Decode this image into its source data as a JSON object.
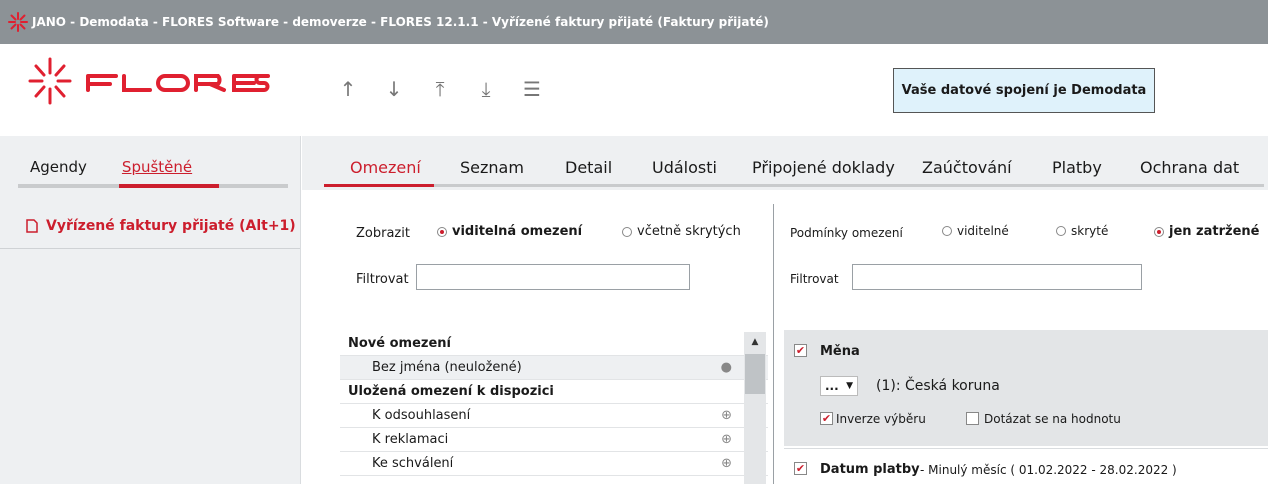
{
  "window": {
    "title": "JANO - Demodata - FLORES Software - demoverze - FLORES 12.1.1 - Vyřízené faktury přijaté  (Faktury přijaté)"
  },
  "header": {
    "logo_text": "FLORES",
    "nav_icons": [
      "arrow-up-icon",
      "arrow-down-icon",
      "arrow-to-top-icon",
      "arrow-to-bottom-icon",
      "menu-icon"
    ],
    "connection_text": "Vaše datové spojení je Demodata"
  },
  "sidebar": {
    "tabs": [
      {
        "label": "Agendy"
      },
      {
        "label": "Spuštěné"
      }
    ],
    "active_tab": "Spuštěné",
    "items": [
      {
        "label": "Vyřízené faktury přijaté (Alt+1)"
      }
    ]
  },
  "tabs": [
    {
      "label": "Omezení"
    },
    {
      "label": "Seznam"
    },
    {
      "label": "Detail"
    },
    {
      "label": "Události"
    },
    {
      "label": "Připojené doklady"
    },
    {
      "label": "Zaúčtování"
    },
    {
      "label": "Platby"
    },
    {
      "label": "Ochrana dat"
    }
  ],
  "left": {
    "show_label": "Zobrazit",
    "show_options": [
      "viditelná omezení",
      "včetně skrytých"
    ],
    "show_selected": "viditelná omezení",
    "filter_label": "Filtrovat",
    "filter_value": "",
    "groups": [
      {
        "label": "Nové omezení",
        "rows": [
          {
            "label": "Bez jména (neuložené)",
            "icon": "user-icon"
          }
        ]
      },
      {
        "label": "Uložená omezení k dispozici",
        "rows": [
          {
            "label": "K odsouhlasení",
            "icon": "globe-icon"
          },
          {
            "label": "K reklamaci",
            "icon": "globe-icon"
          },
          {
            "label": "Ke schválení",
            "icon": "globe-icon"
          }
        ]
      }
    ]
  },
  "right": {
    "conditions_label": "Podmínky omezení",
    "options": [
      "viditelné",
      "skryté",
      "jen zatržené"
    ],
    "selected": "jen zatržené",
    "filter_label": "Filtrovat",
    "filter_value": "",
    "currency": {
      "title": "Měna",
      "checked": true,
      "dropdown": "...",
      "value": "(1): Česká koruna",
      "inverse_label": "Inverze výběru",
      "inverse_checked": true,
      "ask_label": "Dotázat se na hodnotu",
      "ask_checked": false
    },
    "payment_date": {
      "title": "Datum platby",
      "checked": true,
      "detail": "- Minulý měsíc ( 01.02.2022 - 28.02.2022 )"
    }
  }
}
